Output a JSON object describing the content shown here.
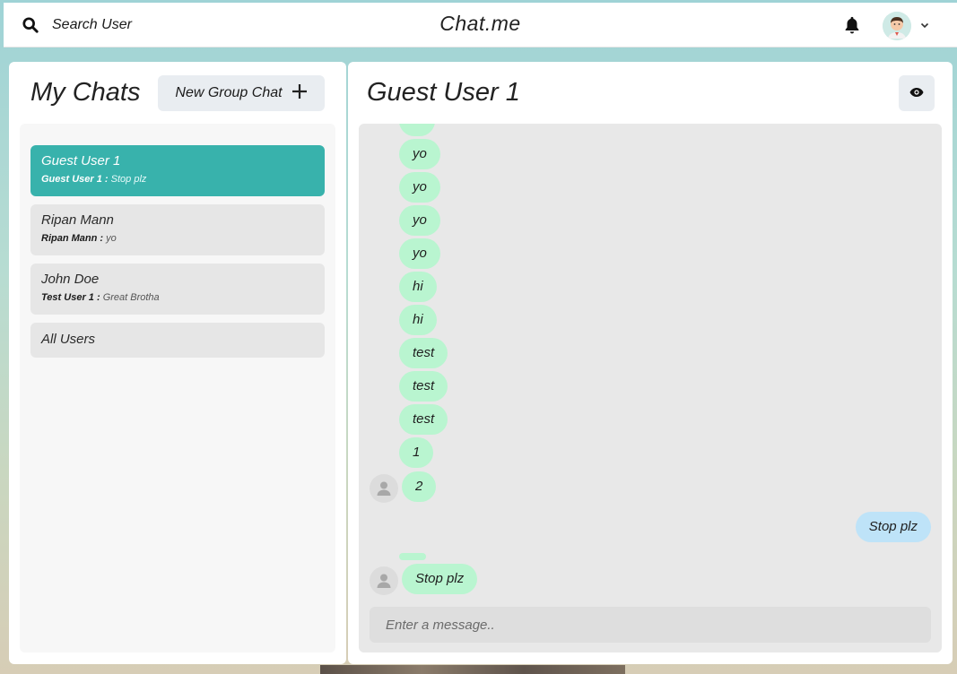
{
  "header": {
    "search_label": "Search User",
    "brand": "Chat.me",
    "icons": {
      "search": "search-icon",
      "bell": "bell-icon",
      "avatar": "user-avatar",
      "dropdown": "chevron-down-icon"
    }
  },
  "left": {
    "title": "My Chats",
    "new_group_label": "New Group Chat",
    "chats": [
      {
        "name": "Guest User 1",
        "sender": "Guest User 1 :",
        "message": "Stop plz",
        "active": true
      },
      {
        "name": "Ripan Mann",
        "sender": "Ripan Mann :",
        "message": "yo",
        "active": false
      },
      {
        "name": "John Doe",
        "sender": "Test User 1 :",
        "message": "Great Brotha",
        "active": false
      },
      {
        "name": "All Users",
        "sender": "",
        "message": "",
        "active": false
      }
    ]
  },
  "right": {
    "title": "Guest User 1",
    "messages": [
      {
        "text": "yo",
        "from": "other"
      },
      {
        "text": "yo",
        "from": "other"
      },
      {
        "text": "yo",
        "from": "other"
      },
      {
        "text": "yo",
        "from": "other"
      },
      {
        "text": "hi",
        "from": "other"
      },
      {
        "text": "hi",
        "from": "other"
      },
      {
        "text": "test",
        "from": "other"
      },
      {
        "text": "test",
        "from": "other"
      },
      {
        "text": "test",
        "from": "other"
      },
      {
        "text": "1",
        "from": "other"
      },
      {
        "text": "2",
        "from": "other"
      },
      {
        "text": "Stop plz",
        "from": "me"
      },
      {
        "text": "Stop plz",
        "from": "other"
      }
    ],
    "input_placeholder": "Enter a message.."
  },
  "colors": {
    "active_chat": "#38b2ac",
    "received_bubble": "#b9f5d0",
    "sent_bubble": "#bee3f8"
  }
}
